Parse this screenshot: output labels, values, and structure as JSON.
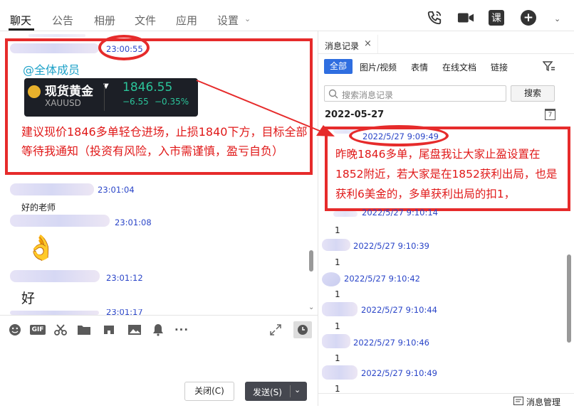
{
  "top_tabs": [
    {
      "label": "聊天"
    },
    {
      "label": "公告"
    },
    {
      "label": "相册"
    },
    {
      "label": "文件"
    },
    {
      "label": "应用"
    },
    {
      "label": "设置"
    }
  ],
  "top_icons": [
    "phone-icon",
    "video-icon",
    "course-icon",
    "add-icon",
    "chevron-down-icon"
  ],
  "course_label": "课",
  "chat": {
    "messages": [
      {
        "time": "23:00:55",
        "mention": "@全体成员"
      },
      {
        "time": "23:01:04",
        "text": "好的老师"
      },
      {
        "time": "23:01:08"
      },
      {
        "time": "23:01:12",
        "text": "好"
      },
      {
        "time": "23:01:17"
      }
    ],
    "gold_card": {
      "name": "现货黄金",
      "code": "XAUUSD",
      "price": "1846.55",
      "change": "−6.55",
      "pct": "−0.35%"
    },
    "highlight_text": "建议现价1846多单轻仓进场，止损1840下方，目标全部等待我通知（投资有风险，入市需谨慎，盈亏自负）"
  },
  "toolbar": [
    "emoji-icon",
    "gif-icon",
    "scissors-icon",
    "folder-icon",
    "phrase-icon",
    "image-icon",
    "bell-icon",
    "more-icon"
  ],
  "buttons": {
    "close": "关闭(C)",
    "send": "发送(S)"
  },
  "history": {
    "title": "消息记录",
    "filters": [
      "全部",
      "图片/视频",
      "表情",
      "在线文档",
      "链接"
    ],
    "search_placeholder": "搜索消息记录",
    "search_btn": "搜索",
    "date": "2022-05-27",
    "highlight": {
      "time": "2022/5/27 9:09:49",
      "text": "昨晚1846多单，尾盘我让大家止盈设置在1852附近，若大家是在1852获利出局，也是获利6美金的，多单获利出局的扣1，"
    },
    "entries": [
      {
        "time": "2022/5/27 9:10:14",
        "text": "1"
      },
      {
        "time": "2022/5/27 9:10:39",
        "text": "1"
      },
      {
        "time": "2022/5/27 9:10:42",
        "text": "1"
      },
      {
        "time": "2022/5/27 9:10:44",
        "text": "1"
      },
      {
        "time": "2022/5/27 9:10:46",
        "text": "1"
      },
      {
        "time": "2022/5/27 9:10:49",
        "text": "1"
      }
    ],
    "manage": "消息管理"
  }
}
